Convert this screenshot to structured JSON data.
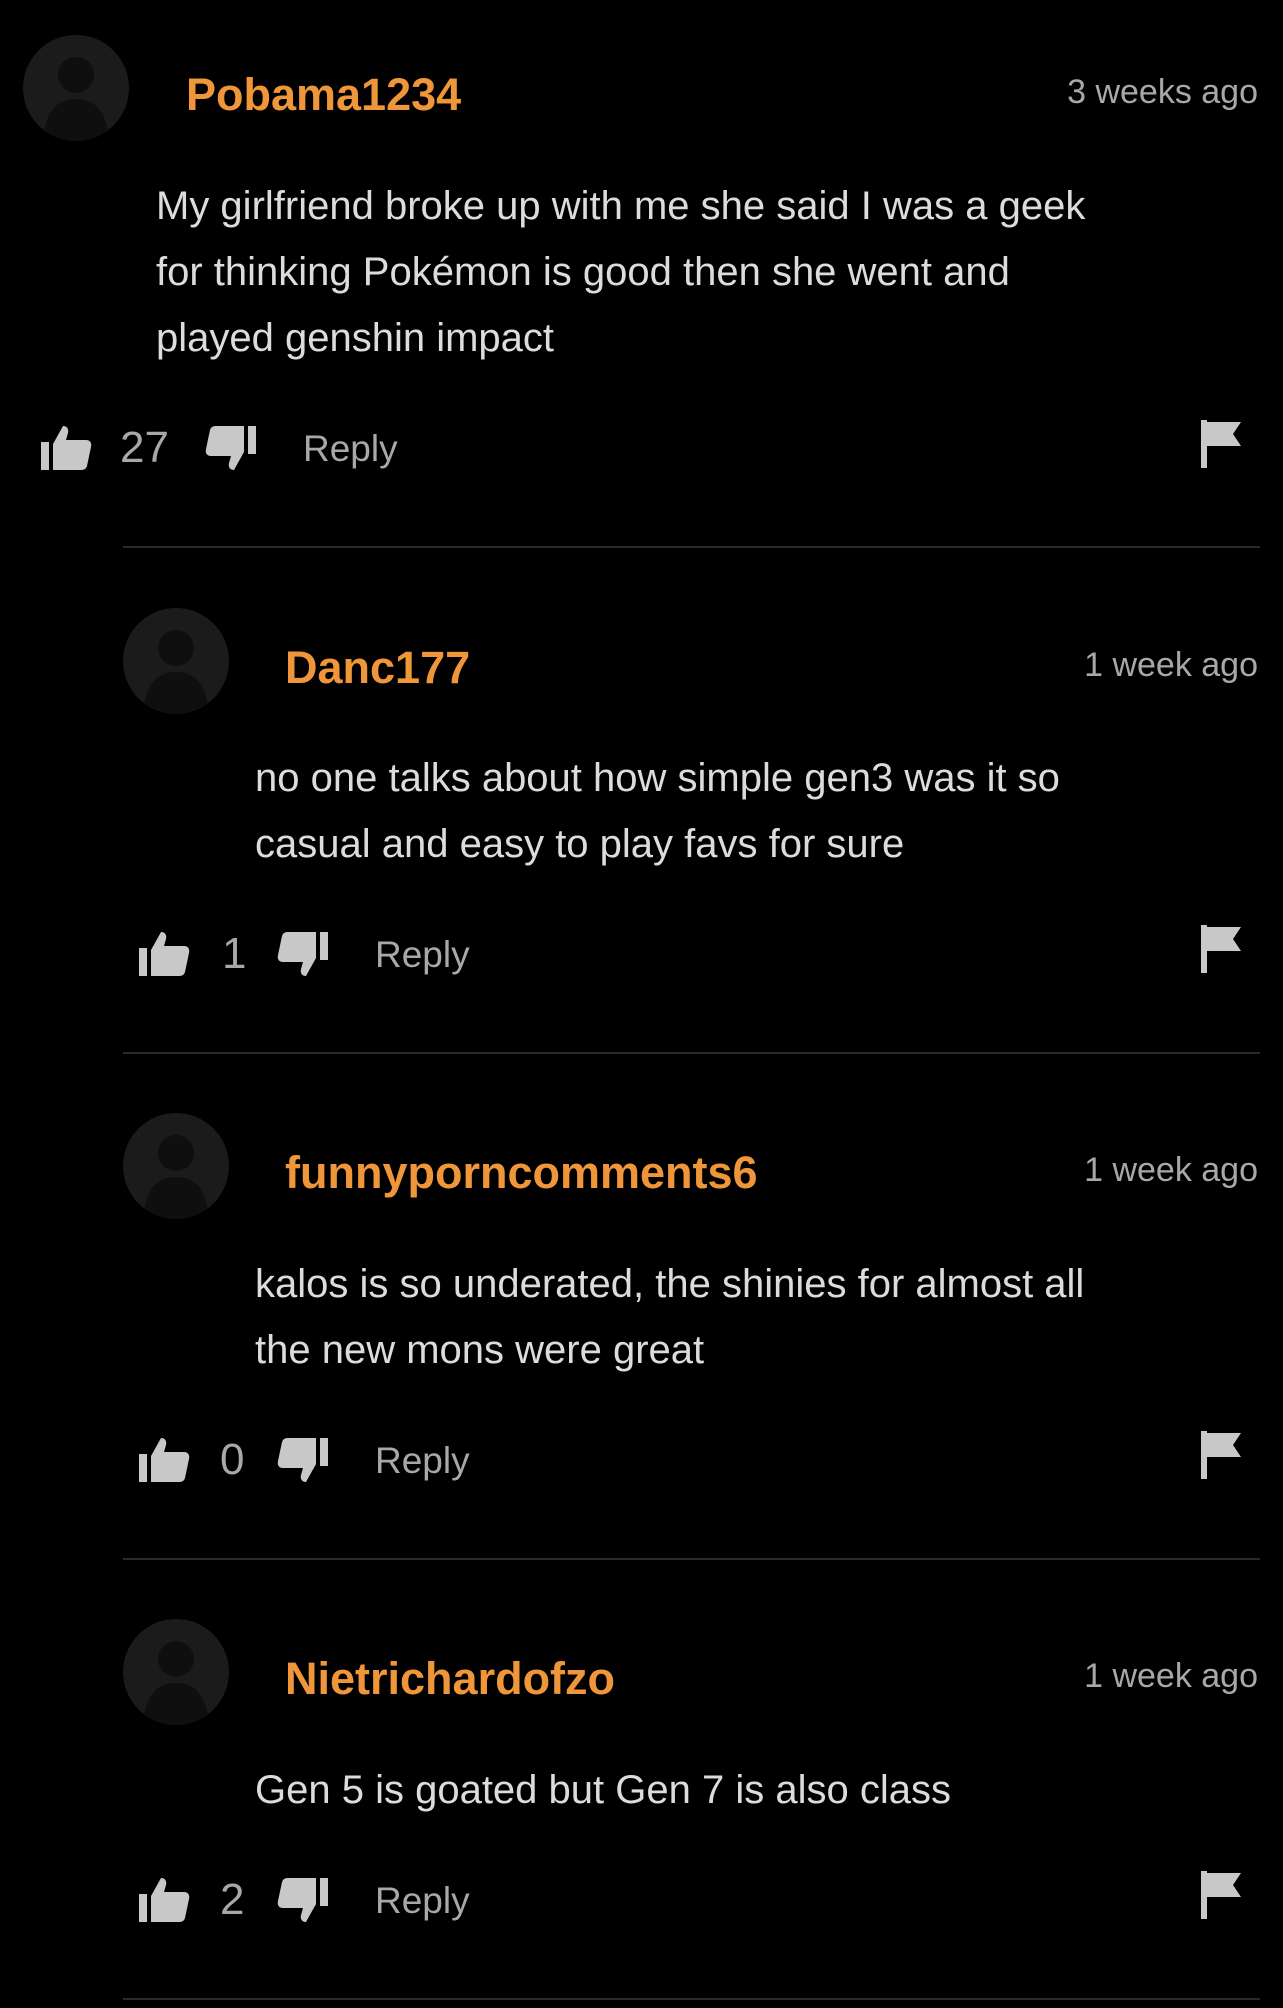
{
  "comments": [
    {
      "username": "Pobama1234",
      "time": "3 weeks ago",
      "lines": [
        "My girlfriend broke up with me she said I was a geek",
        "for thinking Pokémon is good then she went and",
        "played genshin impact"
      ],
      "votes": "27",
      "reply_label": "Reply"
    },
    {
      "username": "Danc177",
      "time": "1 week ago",
      "lines": [
        "no one talks about how simple gen3 was it so",
        "casual and easy to play favs for sure"
      ],
      "votes": "1",
      "reply_label": "Reply"
    },
    {
      "username": "funnyporncomments6",
      "time": "1 week ago",
      "lines": [
        "kalos is so underated, the shinies for almost all",
        "the new mons were great"
      ],
      "votes": "0",
      "reply_label": "Reply"
    },
    {
      "username": "Nietrichardofzo",
      "time": "1 week ago",
      "lines": [
        "Gen 5 is goated but Gen 7 is also class"
      ],
      "votes": "2",
      "reply_label": "Reply"
    }
  ],
  "colors": {
    "background": "#000000",
    "username": "#f0963a",
    "muted": "#a8a8a8",
    "text": "#dcdcdc"
  },
  "icons": [
    "avatar-placeholder-icon",
    "thumbs-up-icon",
    "thumbs-down-icon",
    "flag-icon"
  ]
}
